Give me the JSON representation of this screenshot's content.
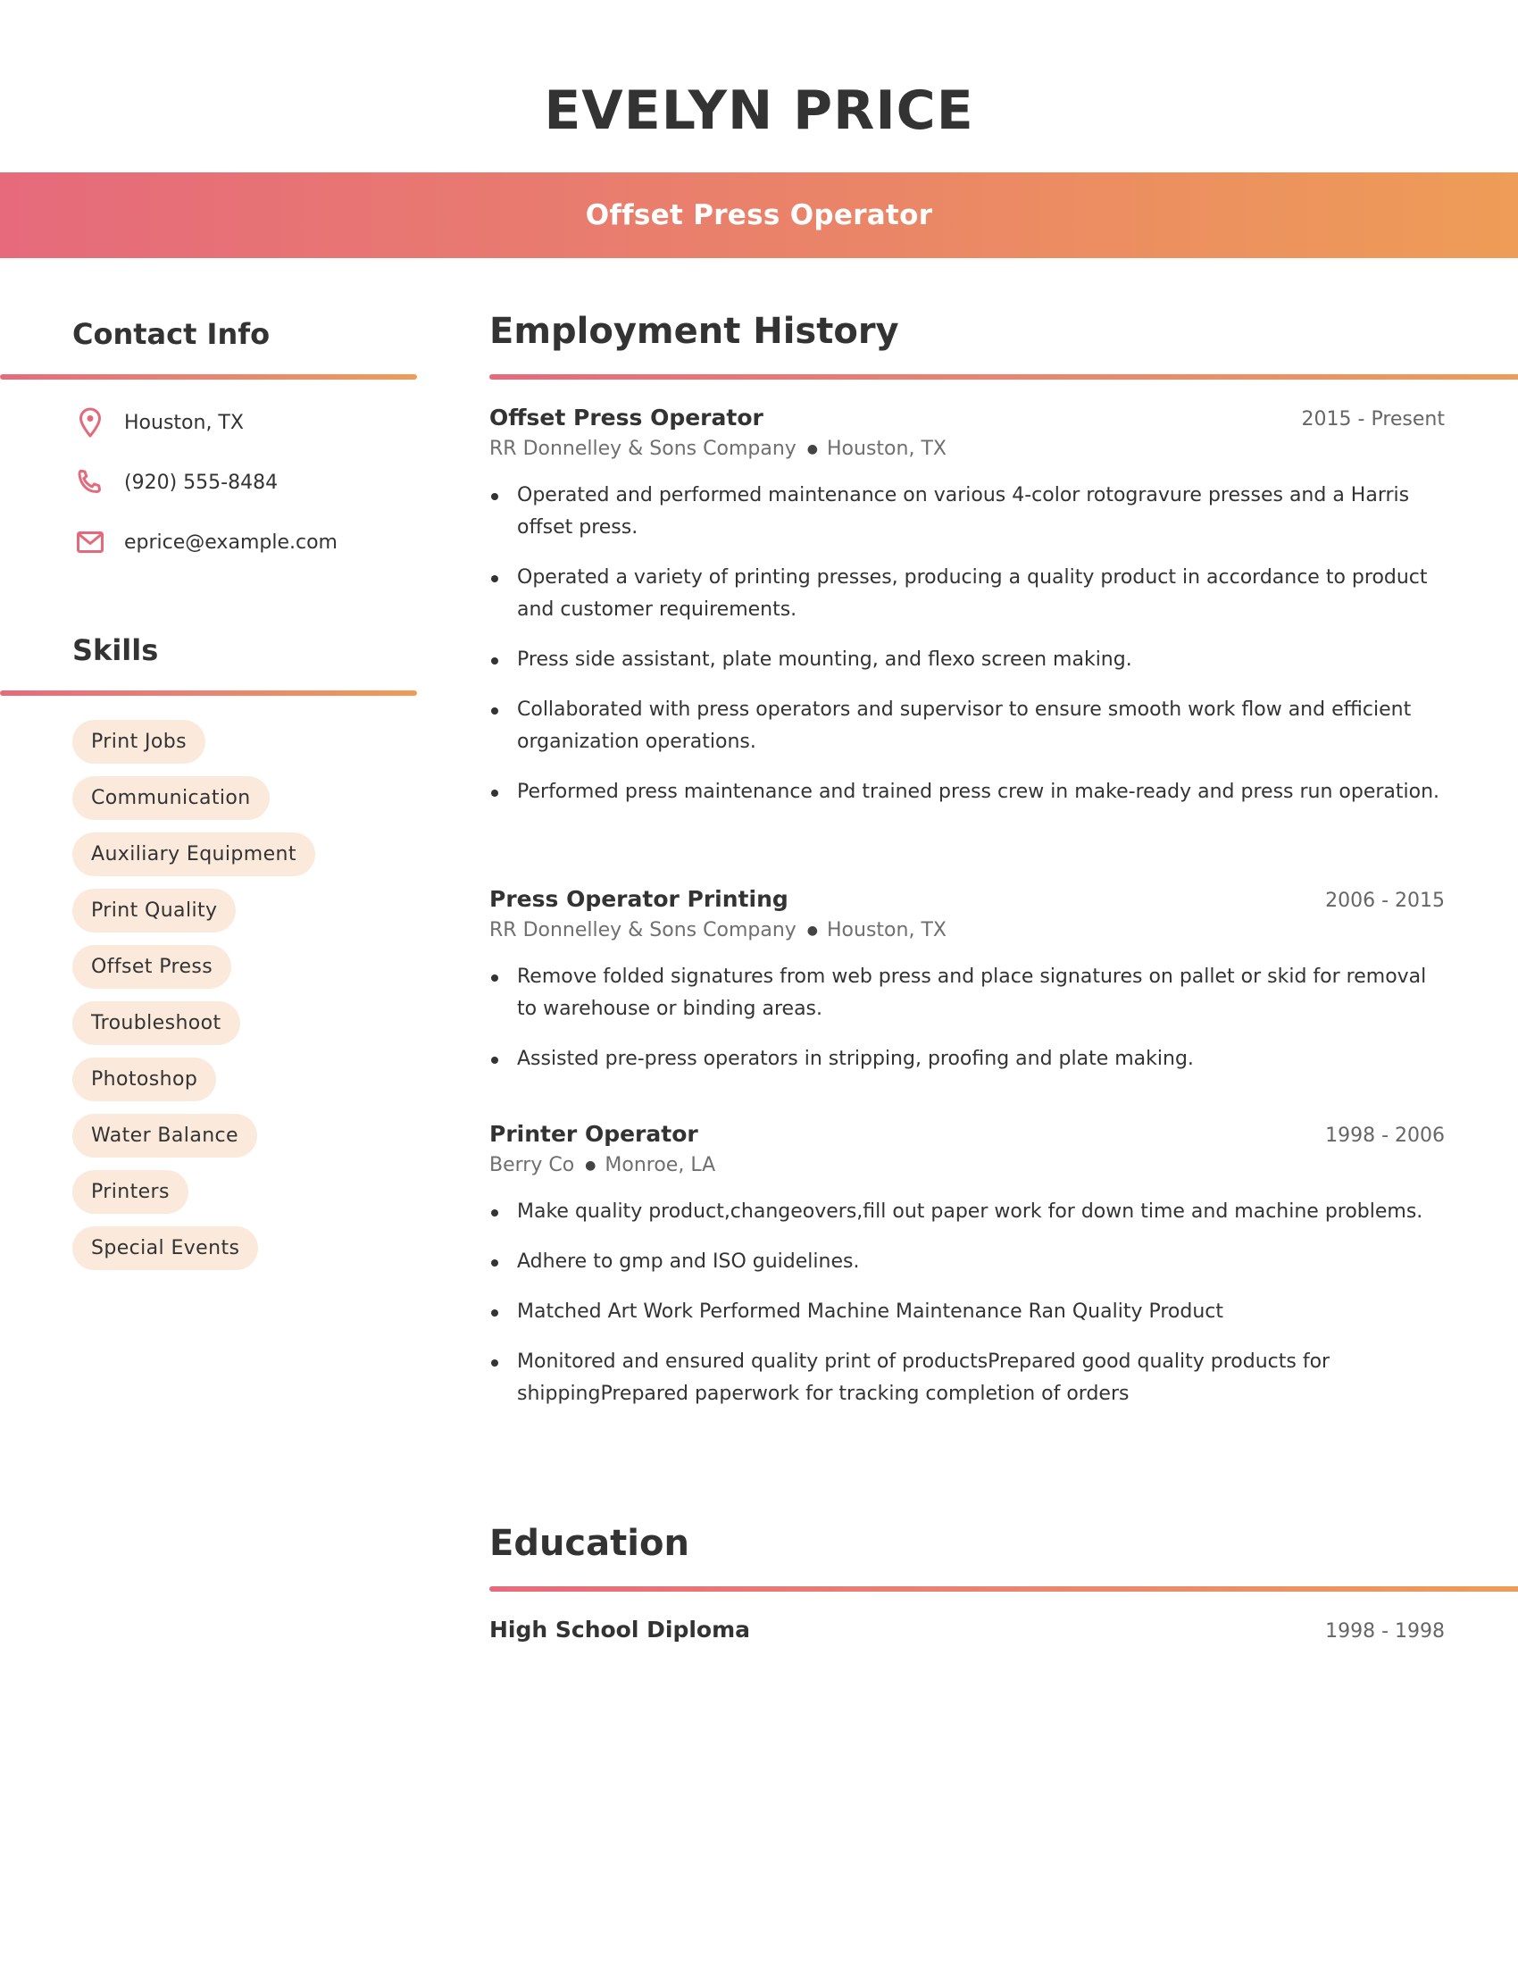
{
  "header": {
    "name": "EVELYN PRICE",
    "title": "Offset Press Operator"
  },
  "colors": {
    "gradient_start": "#e66a7c",
    "gradient_end": "#ee9c57",
    "pill_background": "#fbeadc",
    "text": "#333333"
  },
  "contact": {
    "heading": "Contact Info",
    "items": [
      {
        "icon": "location-pin-icon",
        "text": "Houston, TX"
      },
      {
        "icon": "phone-icon",
        "text": "(920) 555-8484"
      },
      {
        "icon": "mail-icon",
        "text": "eprice@example.com"
      }
    ]
  },
  "skills": {
    "heading": "Skills",
    "items": [
      "Print Jobs",
      "Communication",
      "Auxiliary Equipment",
      "Print Quality",
      "Offset Press",
      "Troubleshoot",
      "Photoshop",
      "Water Balance",
      "Printers",
      "Special Events"
    ]
  },
  "employment": {
    "heading": "Employment History",
    "jobs": [
      {
        "title": "Offset Press Operator",
        "dates": "2015 - Present",
        "company": "RR Donnelley & Sons Company",
        "location": "Houston, TX",
        "bullets": [
          "Operated and performed maintenance on various 4-color rotogravure presses and a Harris offset press.",
          "Operated a variety of printing presses, producing a quality product in accordance to product and customer requirements.",
          "Press side assistant, plate mounting, and flexo screen making.",
          "Collaborated with press operators and supervisor to ensure smooth work flow and efficient organization operations.",
          "Performed press maintenance and trained press crew in make-ready and press run operation."
        ]
      },
      {
        "title": "Press Operator Printing",
        "dates": "2006 - 2015",
        "company": "RR Donnelley & Sons Company",
        "location": "Houston, TX",
        "bullets": [
          "Remove folded signatures from web press and place signatures on pallet or skid for removal to warehouse or binding areas.",
          "Assisted pre-press operators in stripping, proofing and plate making."
        ]
      },
      {
        "title": "Printer Operator",
        "dates": "1998 - 2006",
        "company": "Berry Co",
        "location": "Monroe, LA",
        "bullets": [
          "Make quality product,changeovers,fill out paper work for down time and machine problems.",
          "Adhere to gmp and ISO guidelines.",
          "Matched Art Work Performed Machine Maintenance Ran Quality Product",
          "Monitored and ensured quality print of productsPrepared good quality products for shippingPrepared paperwork for tracking completion of orders"
        ]
      }
    ]
  },
  "education": {
    "heading": "Education",
    "items": [
      {
        "title": "High School Diploma",
        "dates": "1998 - 1998"
      }
    ]
  }
}
